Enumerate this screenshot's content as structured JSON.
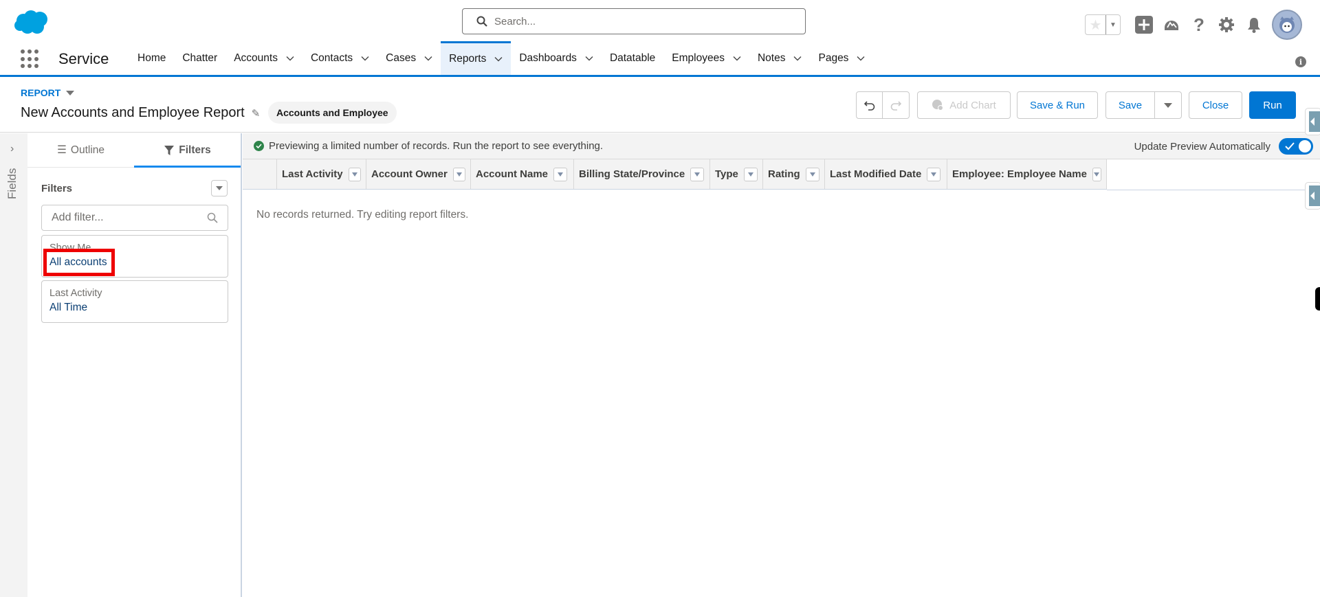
{
  "header": {
    "logo": "salesforce-cloud-logo",
    "search_placeholder": "Search...",
    "icons": [
      "favorites-star-icon",
      "favorites-dropdown-icon",
      "global-actions-plus-icon",
      "trailhead-icon",
      "help-icon",
      "setup-gear-icon",
      "notifications-bell-icon",
      "user-avatar"
    ]
  },
  "nav": {
    "app_name": "Service",
    "items": [
      {
        "label": "Home",
        "dropdown": false,
        "active": false
      },
      {
        "label": "Chatter",
        "dropdown": false,
        "active": false
      },
      {
        "label": "Accounts",
        "dropdown": true,
        "active": false
      },
      {
        "label": "Contacts",
        "dropdown": true,
        "active": false
      },
      {
        "label": "Cases",
        "dropdown": true,
        "active": false
      },
      {
        "label": "Reports",
        "dropdown": true,
        "active": true
      },
      {
        "label": "Dashboards",
        "dropdown": true,
        "active": false
      },
      {
        "label": "Datatable",
        "dropdown": false,
        "active": false
      },
      {
        "label": "Employees",
        "dropdown": true,
        "active": false
      },
      {
        "label": "Notes",
        "dropdown": true,
        "active": false
      },
      {
        "label": "Pages",
        "dropdown": true,
        "active": false
      }
    ],
    "info_glyph": "i"
  },
  "report": {
    "type_label": "REPORT",
    "title": "New Accounts and Employee Report",
    "report_type_badge": "Accounts and Employee",
    "buttons": {
      "add_chart": "Add Chart",
      "save_and_run": "Save & Run",
      "save": "Save",
      "close": "Close",
      "run": "Run"
    }
  },
  "fields_rail": {
    "label": "Fields",
    "chevron": "›"
  },
  "left_panel": {
    "tabs": [
      {
        "label": "Outline",
        "active": false
      },
      {
        "label": "Filters",
        "active": true
      }
    ],
    "filters_heading": "Filters",
    "add_filter_placeholder": "Add filter...",
    "filters": [
      {
        "label": "Show Me",
        "value": "All accounts"
      },
      {
        "label": "Last Activity",
        "value": "All Time"
      }
    ]
  },
  "preview": {
    "message": "Previewing a limited number of records. Run the report to see everything.",
    "auto_update_label": "Update Preview Automatically",
    "auto_update_on": true
  },
  "table": {
    "columns": [
      "Last Activity",
      "Account Owner",
      "Account Name",
      "Billing State/Province",
      "Type",
      "Rating",
      "Last Modified Date",
      "Employee: Employee Name"
    ],
    "rows": [],
    "empty_message": "No records returned. Try editing report filters."
  },
  "colors": {
    "brand_blue": "#0176d3",
    "highlight_red": "#ee0000",
    "success_green": "#2e844a"
  }
}
